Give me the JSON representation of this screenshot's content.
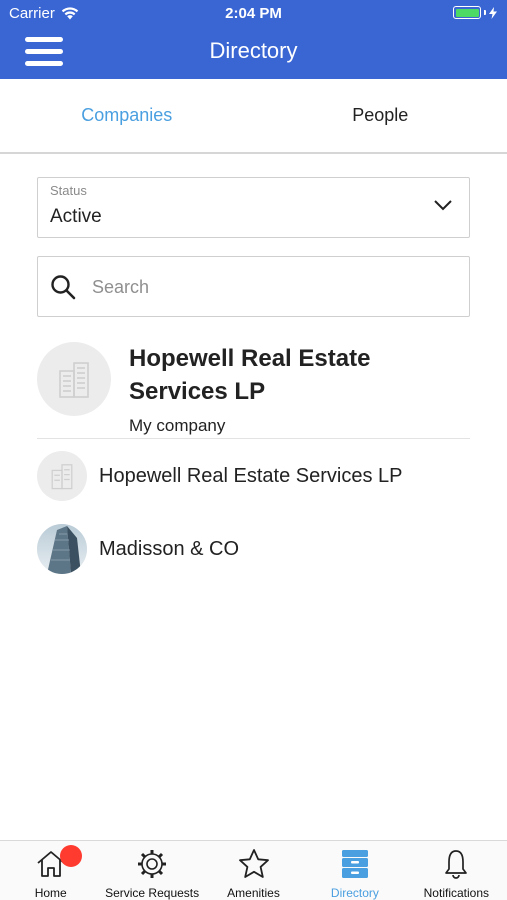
{
  "status_bar": {
    "carrier": "Carrier",
    "time": "2:04 PM"
  },
  "header": {
    "title": "Directory"
  },
  "tabs": [
    {
      "label": "Companies",
      "active": true
    },
    {
      "label": "People",
      "active": false
    }
  ],
  "status_filter": {
    "label": "Status",
    "value": "Active"
  },
  "search": {
    "placeholder": "Search"
  },
  "my_company": {
    "name": "Hopewell Real Estate Services LP",
    "subtitle": "My company"
  },
  "companies": [
    {
      "name": "Hopewell Real Estate Services LP",
      "icon": "building-icon"
    },
    {
      "name": "Madisson & CO",
      "icon": "skyscraper-photo"
    }
  ],
  "bottom_nav": [
    {
      "label": "Home",
      "icon": "home-icon",
      "badge": true
    },
    {
      "label": "Service Requests",
      "icon": "gear-icon"
    },
    {
      "label": "Amenities",
      "icon": "star-icon"
    },
    {
      "label": "Directory",
      "icon": "directory-icon",
      "active": true
    },
    {
      "label": "Notifications",
      "icon": "bell-icon"
    }
  ],
  "colors": {
    "header": "#3a66d4",
    "accent": "#4a9fe0",
    "badge": "#ff3b30",
    "battery": "#4cd964"
  }
}
